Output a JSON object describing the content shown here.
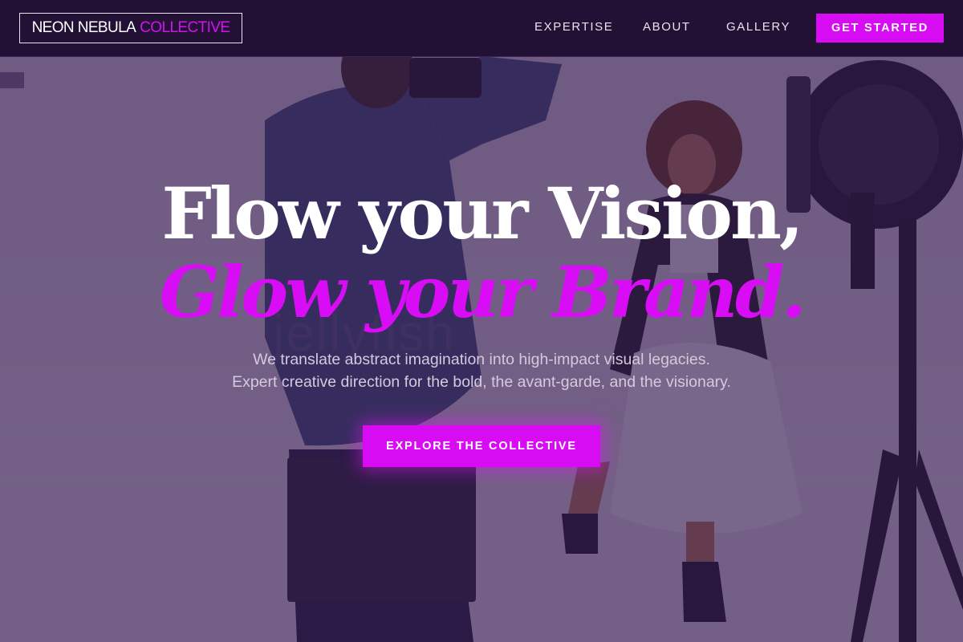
{
  "brand": {
    "name_main": "NEON NEBULA",
    "name_accent": "COLLECTIVE",
    "accent_color": "#d70cf3"
  },
  "nav": {
    "links": [
      "EXPERTISE",
      "ABOUT",
      "GALLERY"
    ],
    "cta_label": "GET STARTED"
  },
  "hero": {
    "headline_line1": "Flow your Vision,",
    "headline_line2": "Glow your Brand.",
    "subtitle_line1": "We translate abstract imagination into high-impact visual legacies.",
    "subtitle_line2": "Expert creative direction for the bold, the avant-garde, and the visionary.",
    "cta_label": "EXPLORE THE COLLECTIVE",
    "background": "photo-studio-shoot",
    "watermark": "jellyfish"
  }
}
